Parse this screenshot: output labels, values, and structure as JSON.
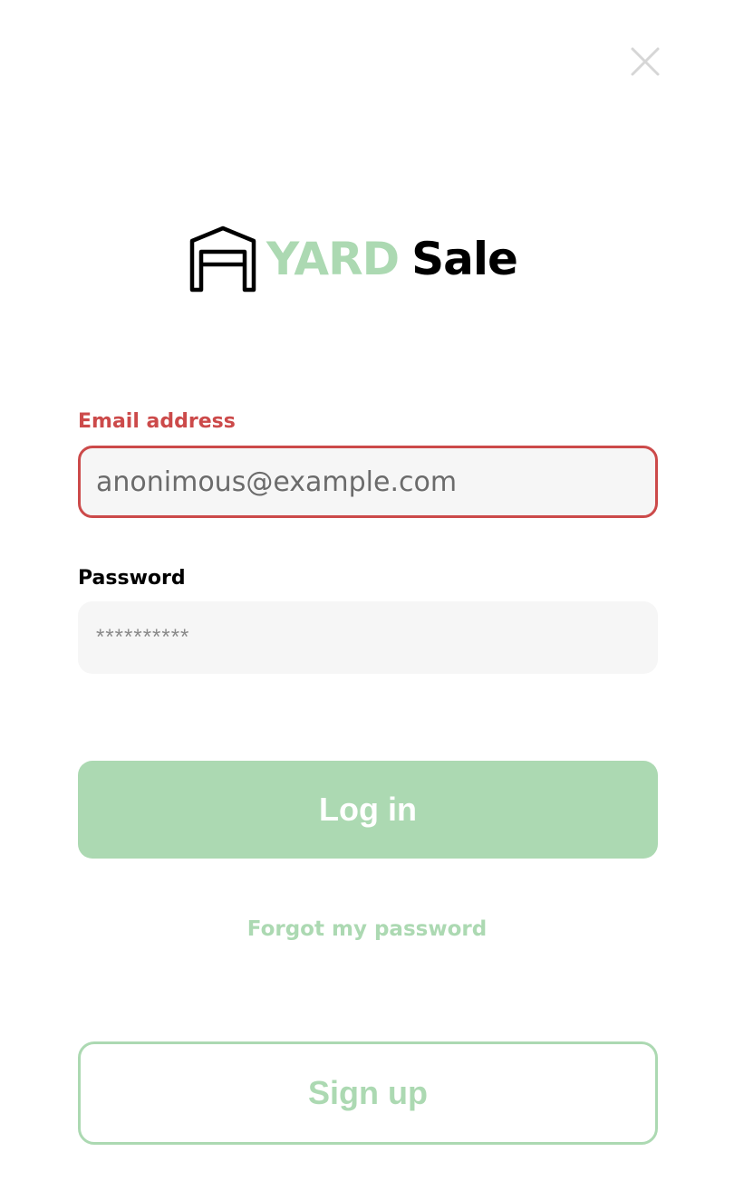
{
  "colors": {
    "accent": "#acd9b2",
    "error": "#cc4a4a",
    "input_bg": "#f6f6f6",
    "close_icon": "#d6d6d6",
    "text_dark": "#000000"
  },
  "header": {
    "close_icon": "close-icon"
  },
  "logo": {
    "icon": "garage-icon",
    "word1": "YARD",
    "word2": "Sale"
  },
  "form": {
    "email": {
      "label": "Email address",
      "value": "anonimous@example.com",
      "state": "error"
    },
    "password": {
      "label": "Password",
      "value": "**********"
    }
  },
  "actions": {
    "login_label": "Log in",
    "forgot_label": "Forgot my password",
    "signup_label": "Sign up"
  }
}
